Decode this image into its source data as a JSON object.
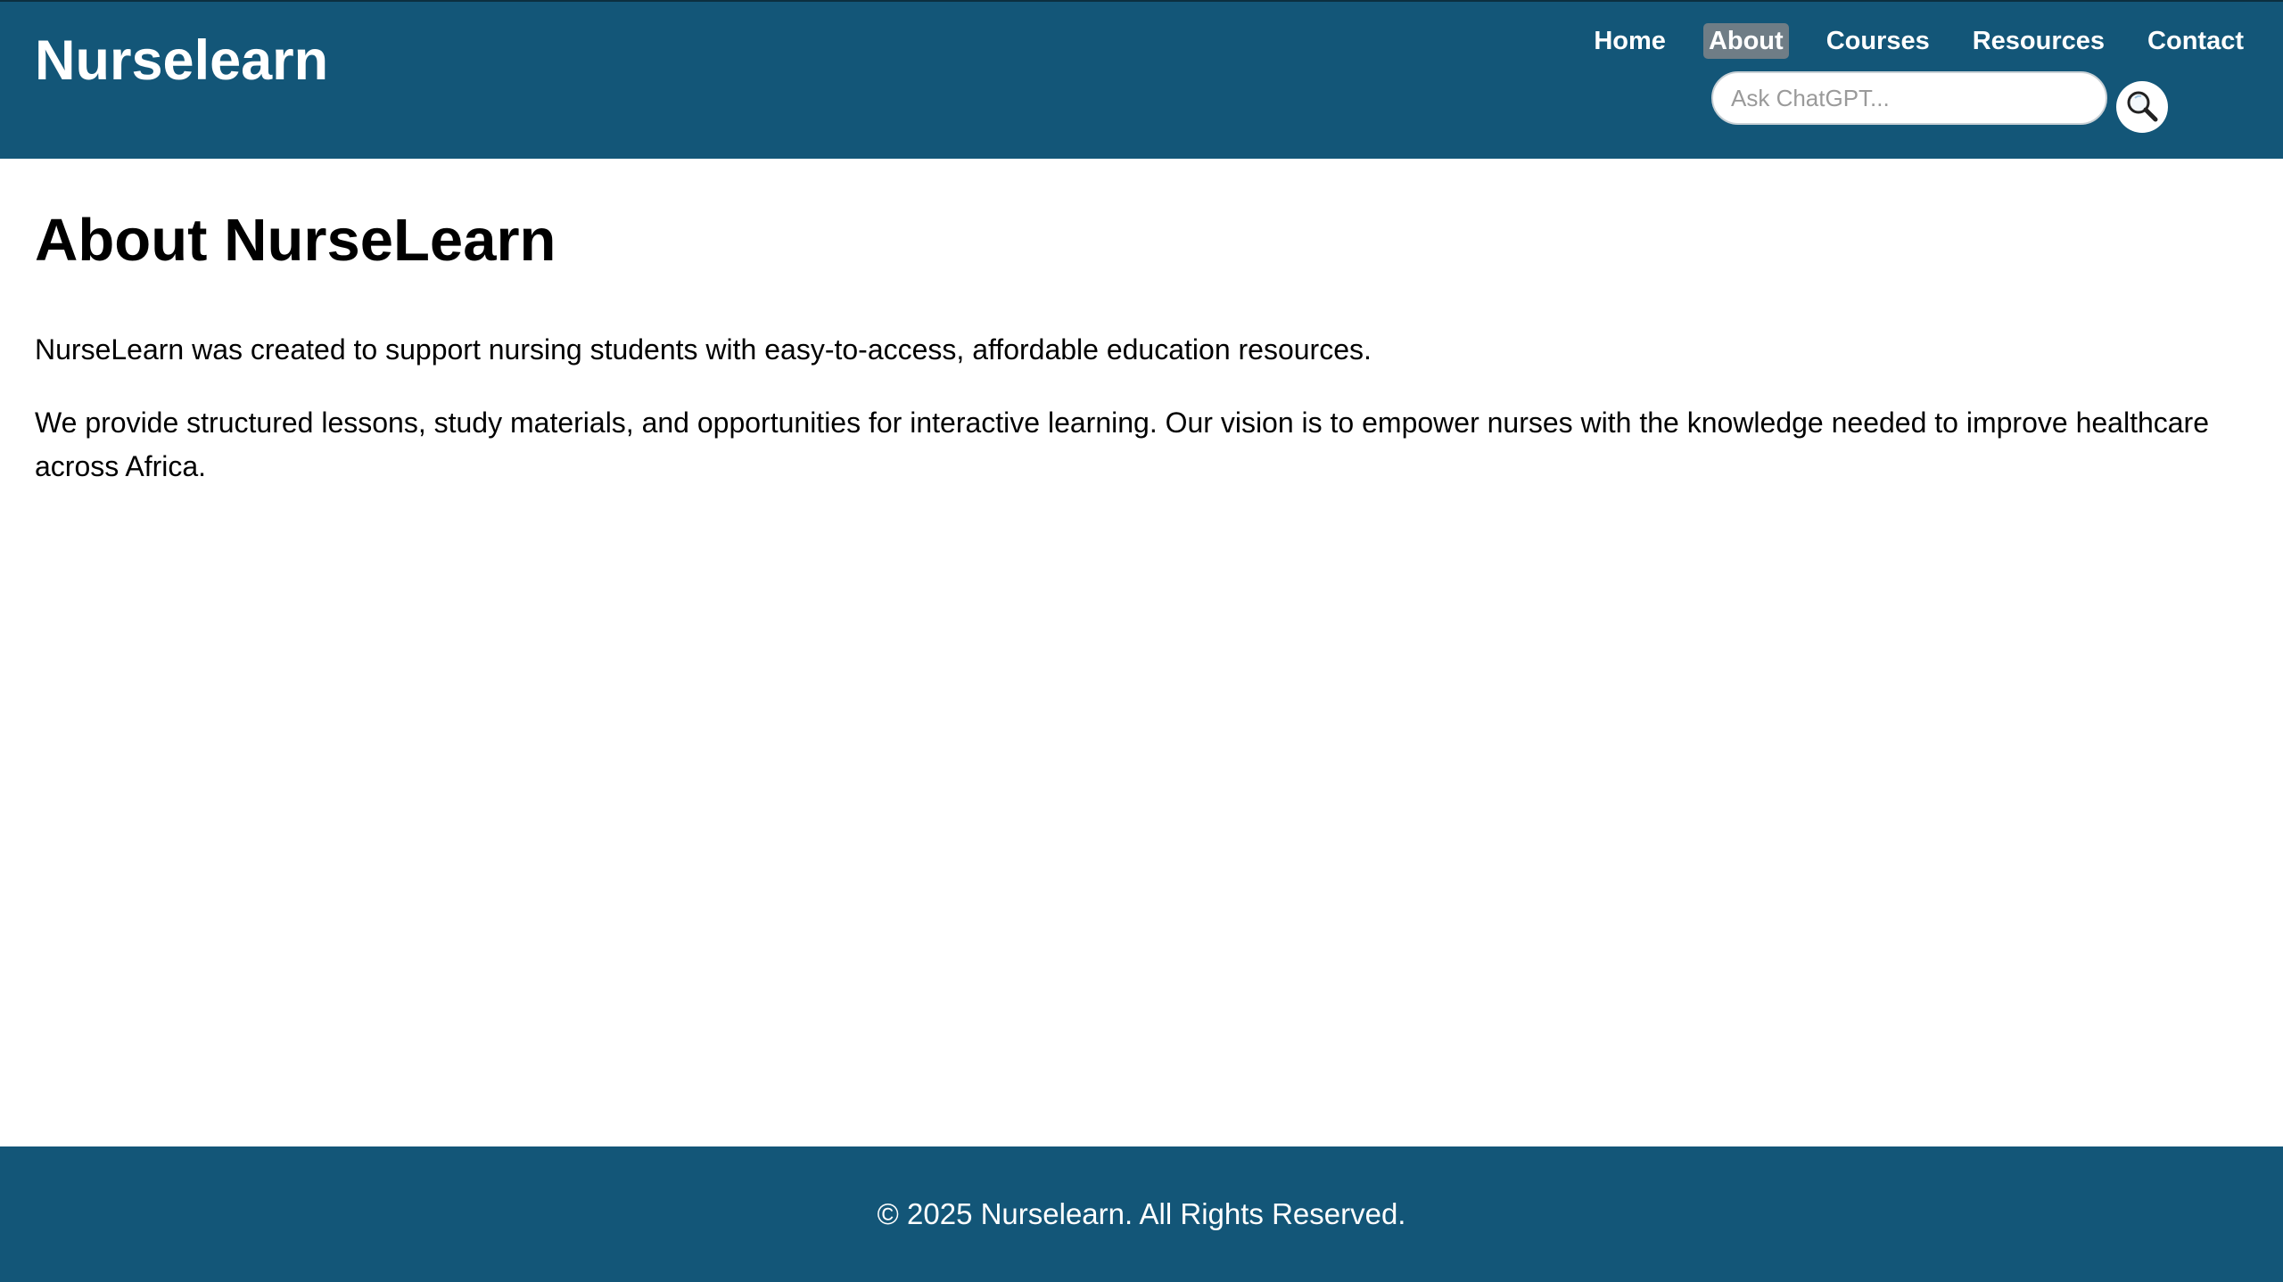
{
  "header": {
    "logo": "Nurselearn",
    "nav": [
      {
        "label": "Home",
        "active": false
      },
      {
        "label": "About",
        "active": true
      },
      {
        "label": "Courses",
        "active": false
      },
      {
        "label": "Resources",
        "active": false
      },
      {
        "label": "Contact",
        "active": false
      }
    ],
    "search": {
      "placeholder": "Ask ChatGPT...",
      "value": "",
      "button_icon": "magnifier-icon"
    }
  },
  "main": {
    "title": "About NurseLearn",
    "paragraphs": [
      "NurseLearn was created to support nursing students with easy-to-access, affordable education resources.",
      "We provide structured lessons, study materials, and opportunities for interactive learning. Our vision is to empower nurses with the knowledge needed to improve healthcare across Africa."
    ]
  },
  "footer": {
    "copyright": "© 2025 Nurselearn. All Rights Reserved."
  },
  "colors": {
    "header_bg": "#135678",
    "footer_bg": "#135678",
    "active_nav_bg": "#6f7d86",
    "text_light": "#ffffff"
  }
}
